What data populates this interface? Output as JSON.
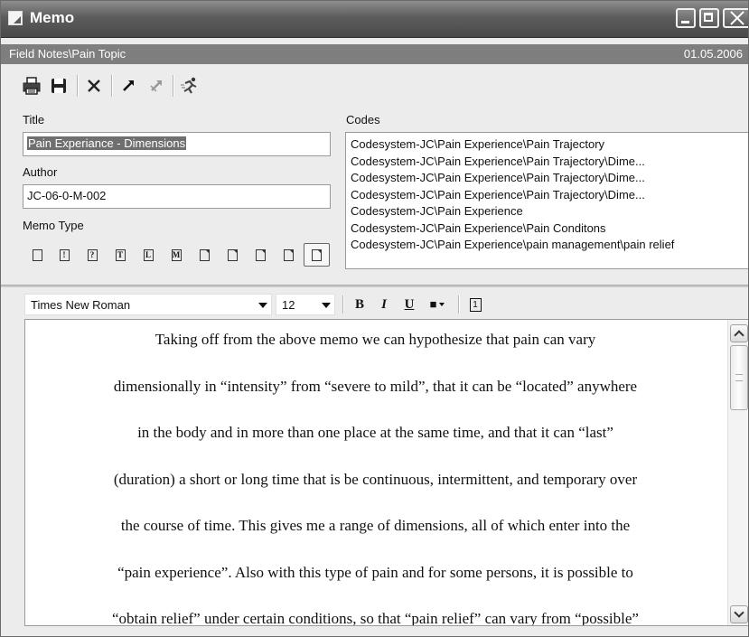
{
  "window": {
    "title": "Memo",
    "icons": [
      "memo-app-icon",
      "minimize-icon",
      "maximize-icon",
      "close-icon"
    ]
  },
  "pathbar": {
    "path": "Field Notes\\Pain Topic",
    "date": "01.05.2006"
  },
  "toolbar": {
    "icons": [
      "print-icon",
      "save-icon",
      "delete-icon",
      "link-icon",
      "unlink-icon",
      "run-icon"
    ]
  },
  "form": {
    "title_label": "Title",
    "title_value": "Pain Experiance - Dimensions",
    "author_label": "Author",
    "author_value": "JC-06-0-M-002",
    "memo_type_label": "Memo Type",
    "memo_types": [
      "",
      "!",
      "?",
      "T",
      "L",
      "M",
      "",
      "",
      "",
      "",
      ""
    ],
    "selected_memo_type_index": 10
  },
  "codes": {
    "label": "Codes",
    "items": [
      "Codesystem-JC\\Pain Experience\\Pain Trajectory",
      "Codesystem-JC\\Pain Experience\\Pain Trajectory\\Dime...",
      "Codesystem-JC\\Pain Experience\\Pain Trajectory\\Dime...",
      "Codesystem-JC\\Pain Experience\\Pain Trajectory\\Dime...",
      "Codesystem-JC\\Pain Experience",
      "Codesystem-JC\\Pain Experience\\Pain Conditons",
      "Codesystem-JC\\Pain Experience\\pain management\\pain relief"
    ]
  },
  "format": {
    "font": "Times New Roman",
    "size": "12",
    "bold": "B",
    "italic": "I",
    "underline": "U",
    "color": "■",
    "page": "1"
  },
  "editor": {
    "lines": [
      "Taking off from the above memo we can hypothesize that pain can vary",
      "dimensionally in “intensity” from “severe to mild”, that it can be “located” anywhere",
      "in the body and in more than one place at the same time, and that it can “last”",
      "(duration) a short or long time that is be continuous, intermittent, and temporary over",
      "the course of time.  This gives me a range of dimensions, all of which enter into the",
      "“pain experience”.  Also with this type of pain and for some persons, it is possible to",
      "“obtain relief” under certain conditions, so that “pain relief” can vary from “possible”"
    ]
  }
}
